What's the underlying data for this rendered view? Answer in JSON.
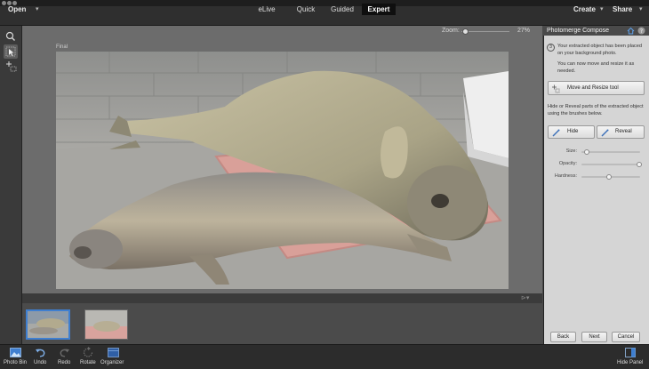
{
  "menubar": {
    "open_label": "Open",
    "create_label": "Create",
    "share_label": "Share",
    "caret": "▾"
  },
  "mode_tabs": [
    {
      "label": "eLive",
      "active": false
    },
    {
      "label": "Quick",
      "active": false
    },
    {
      "label": "Guided",
      "active": false
    },
    {
      "label": "Expert",
      "active": true
    }
  ],
  "tools": [
    "zoom-tool",
    "move-tool",
    "photomerge-compose-tool"
  ],
  "zoom": {
    "label": "Zoom:",
    "value_text": "27%",
    "percent": 27
  },
  "document": {
    "layer_label": "Final"
  },
  "panel": {
    "title": "Photomerge Compose",
    "step_number": "3",
    "step_text_1": "Your extracted object has been placed on your background photo.",
    "step_text_2": "You can now move and resize it as needed.",
    "move_resize_button": "Move and Resize tool",
    "hide_reveal_text": "Hide or Reveal parts of the extracted object using the brushes below.",
    "hide_button": "Hide",
    "reveal_button": "Reveal",
    "sliders": [
      {
        "label": "Size:",
        "value": 0.05
      },
      {
        "label": "Opacity:",
        "value": 1.0
      },
      {
        "label": "Hardness:",
        "value": 0.45
      }
    ],
    "back_button": "Back",
    "next_button": "Next",
    "cancel_button": "Cancel"
  },
  "bottombar": {
    "photo_bin": "Photo Bin",
    "undo": "Undo",
    "redo": "Redo",
    "rotate": "Rotate",
    "organizer": "Organizer",
    "hide_panel": "Hide Panel"
  },
  "colors": {
    "accent_blue": "#3f7fd0",
    "active_tab_bg": "#0f0f0f",
    "panel_bg": "#d5d5d5"
  }
}
